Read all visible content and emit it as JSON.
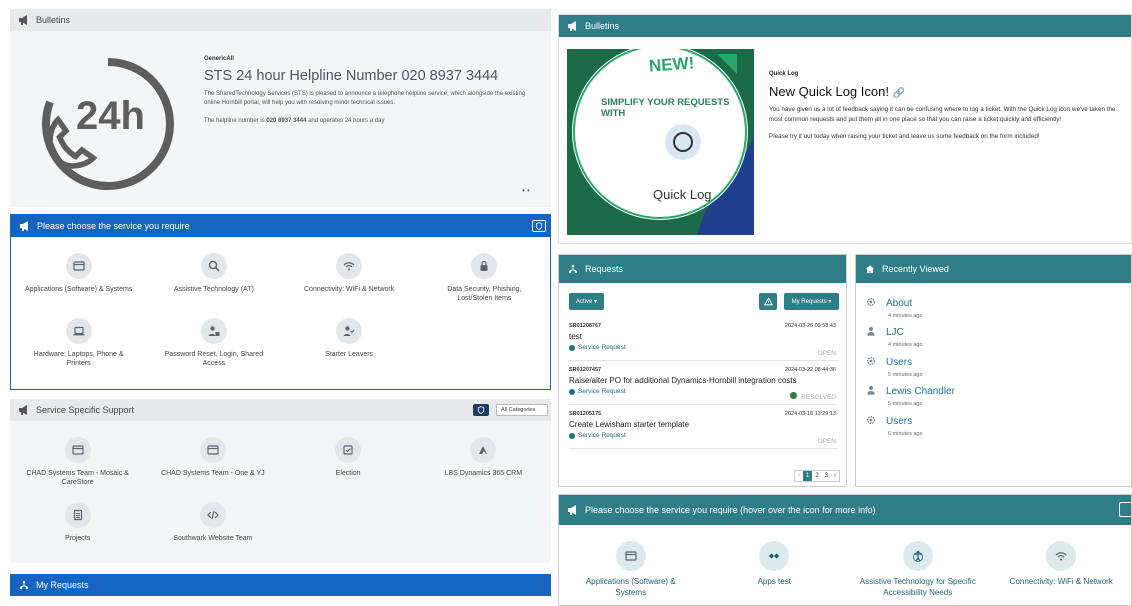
{
  "left": {
    "bulletins": {
      "header": "Bulletins",
      "author": "GenericAll",
      "title": "STS 24 hour Helpline Number 020 8937 3444",
      "body1": "The SharedTechnology Services (STS) is pleased to announce a telephone helpline service, which alongside the existing online Hornbill portal, will help you with resolving minor technical issues.",
      "body2_prefix": "The helpline number is ",
      "body2_bold": "020 8937 3444",
      "body2_suffix": " and operates 24 hours a day",
      "image_label": "24h"
    },
    "choose": {
      "header": "Please choose the service you require",
      "items": [
        {
          "label": "Applications (Software) & Systems",
          "icon": "window-icon"
        },
        {
          "label": "Assistive Technology (AT)",
          "icon": "magnifier-icon"
        },
        {
          "label": "Connectivity: WiFi & Network",
          "icon": "wifi-icon"
        },
        {
          "label": "Data Security, Phishing, Lost/Stolen Items",
          "icon": "lock-icon"
        },
        {
          "label": "Hardware: Laptops, Phone & Printers",
          "icon": "laptop-icon"
        },
        {
          "label": "Password Reset, Login, Shared Access",
          "icon": "user-lock-icon"
        },
        {
          "label": "Starter Leavers",
          "icon": "user-check-icon"
        }
      ]
    },
    "specific": {
      "header": "Service Specific Support",
      "filter": "All Categories",
      "items": [
        {
          "label": "CHAD Systems Team - Mosaic & CareStore",
          "icon": "window-icon"
        },
        {
          "label": "CHAD Systems Team - One & YJ",
          "icon": "window-icon"
        },
        {
          "label": "Election",
          "icon": "checkbox-icon"
        },
        {
          "label": "LBS Dynamics 365 CRM",
          "icon": "dynamics-icon"
        },
        {
          "label": "Projects",
          "icon": "document-icon"
        },
        {
          "label": "Southwark Website Team",
          "icon": "code-icon"
        }
      ]
    },
    "my_requests": {
      "header": "My Requests"
    }
  },
  "right": {
    "bulletins": {
      "header": "Bulletins",
      "image_new": "NEW!",
      "image_tagline": "SIMPLIFY YOUR REQUESTS WITH",
      "image_quicklog": "Quick Log",
      "category": "Quick Log",
      "title": "New Quick Log Icon!",
      "body1": "You have given us a lot of feedback saying it can be confusing where to log a ticket. With the Quick Log icon we've taken the most common requests and put them all in one place so that you can raise a ticket quickly and efficiently!",
      "body2": "Please try it out today when raising your ticket and leave us some feedback on the form included!"
    },
    "requests": {
      "header": "Requests",
      "filter": "Active",
      "scope": "My Requests",
      "items": [
        {
          "ref": "SR01208767",
          "date": "2024-03-26 09:53:43",
          "title": "test",
          "type": "Service Request",
          "status": "OPEN"
        },
        {
          "ref": "SR01207457",
          "date": "2024-03-22 08:44:36",
          "title": "Raise/alter PO for additional Dynamics-Hornbill integration costs",
          "type": "Service Request",
          "status": "RESOLVED"
        },
        {
          "ref": "SR01205175",
          "date": "2024-03-18 13:29:13",
          "title": "Create Lewisham starter template",
          "type": "Service Request",
          "status": "OPEN"
        }
      ],
      "pages": [
        "1",
        "2",
        "3"
      ]
    },
    "recent": {
      "header": "Recently Viewed",
      "items": [
        {
          "name": "About",
          "ago": "4 minutes ago",
          "icon": "gear-icon"
        },
        {
          "name": "LJC",
          "ago": "4 minutes ago",
          "icon": "user-icon"
        },
        {
          "name": "Users",
          "ago": "5 minutes ago",
          "icon": "gear-icon"
        },
        {
          "name": "Lewis Chandler",
          "ago": "5 minutes ago",
          "icon": "user-icon"
        },
        {
          "name": "Users",
          "ago": "6 minutes ago",
          "icon": "gear-icon"
        }
      ]
    },
    "choose": {
      "header": "Please choose the service you require (hover over the icon for more info)",
      "items": [
        {
          "label": "Applications (Software) & Systems",
          "icon": "window-icon"
        },
        {
          "label": "Apps test",
          "icon": "apps-icon"
        },
        {
          "label": "Assistive Technology for Specific Accessibility Needs",
          "icon": "accessibility-icon"
        },
        {
          "label": "Connectivity: WiFi & Network",
          "icon": "wifi-icon"
        }
      ]
    }
  },
  "colors": {
    "blue": "#1565c0",
    "teal": "#2f7d86",
    "grey_header": "#e8e9eb",
    "link": "#1e6f8a"
  }
}
